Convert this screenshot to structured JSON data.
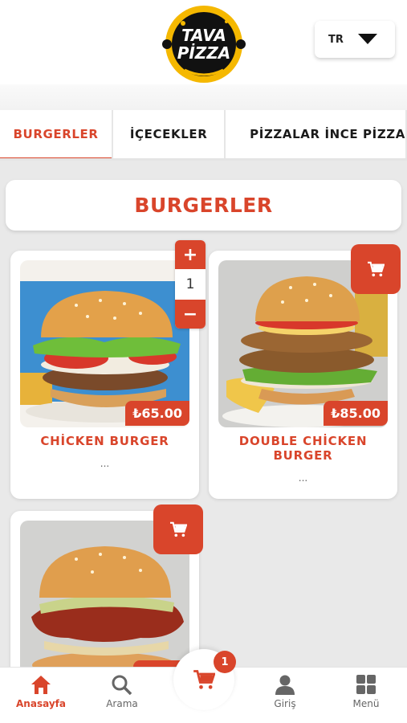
{
  "header": {
    "logo_text_line1": "TAVA",
    "logo_text_line2": "PİZZA",
    "language": "TR"
  },
  "tabs": [
    {
      "label": "BURGERLER",
      "active": true
    },
    {
      "label": "İÇECEKLER",
      "active": false
    },
    {
      "label": "PİZZALAR İNCE PİZZA",
      "active": false
    }
  ],
  "section": {
    "title": "BURGERLER"
  },
  "products": [
    {
      "name": "CHİCKEN BURGER",
      "price": "₺65.00",
      "description": "...",
      "quantity": "1"
    },
    {
      "name": "DOUBLE CHİCKEN BURGER",
      "price": "₺85.00",
      "description": "..."
    },
    {
      "name": "",
      "price": "",
      "description": ""
    }
  ],
  "bottom_nav": {
    "home": "Anasayfa",
    "search": "Arama",
    "cart_count": "1",
    "login": "Giriş",
    "menu": "Menü"
  },
  "colors": {
    "accent": "#d9452b",
    "logo_yellow": "#f5b800",
    "background": "#e9e9e9"
  },
  "icons": [
    "home-icon",
    "search-icon",
    "cart-icon",
    "user-icon",
    "grid-icon",
    "chevron-down-icon"
  ]
}
